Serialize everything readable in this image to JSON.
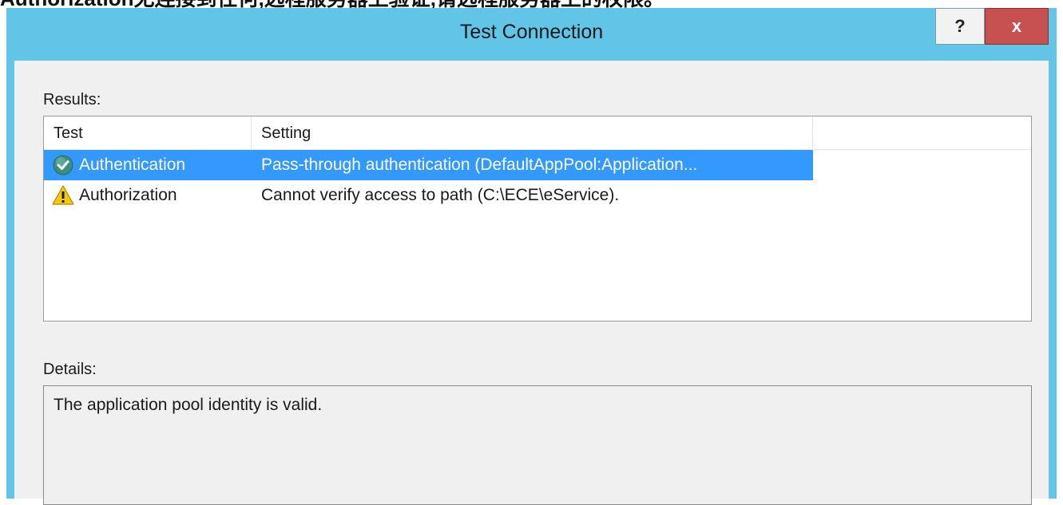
{
  "caption": "Authorization无连接到任何,远程服务器上验证,请远程服务器上的权限。",
  "window": {
    "title": "Test Connection",
    "help_label": "?",
    "close_label": "x"
  },
  "results": {
    "label": "Results:",
    "columns": [
      "Test",
      "Setting"
    ],
    "rows": [
      {
        "test": "Authentication",
        "setting": "Pass-through authentication (DefaultAppPool:Application...",
        "status_icon": "success-check-icon",
        "selected": true
      },
      {
        "test": "Authorization",
        "setting": "Cannot verify access to path (C:\\ECE\\eService).",
        "status_icon": "warning-icon",
        "selected": false
      }
    ]
  },
  "details": {
    "label": "Details:",
    "text": "The application pool identity is valid."
  },
  "colors": {
    "titlebar": "#62c4e6",
    "selection": "#3399ff",
    "close_button": "#c75050"
  }
}
